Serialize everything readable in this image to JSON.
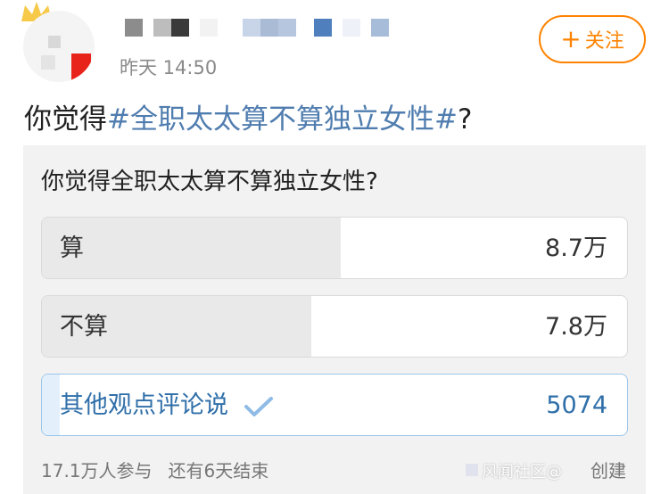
{
  "post": {
    "time": "昨天 14:50",
    "follow_label": "关注",
    "follow_plus": "+",
    "text_prefix": "你觉得",
    "topic": "#全职太太算不算独立女性#",
    "text_suffix": "?"
  },
  "poll": {
    "question": "你觉得全职太太算不算独立女性?",
    "options": [
      {
        "label": "算",
        "count": "8.7万",
        "share": 0.51,
        "selected": false
      },
      {
        "label": "不算",
        "count": "7.8万",
        "share": 0.46,
        "selected": false
      },
      {
        "label": "其他观点评论说",
        "count": "5074",
        "share": 0.03,
        "selected": true
      }
    ],
    "participants": "17.1万人参与",
    "remaining": "还有6天结束",
    "creator_label": "创建"
  },
  "colors": {
    "accent": "#ff8200",
    "topic": "#507daf",
    "selected": "#2f6fa9"
  },
  "watermark": "风闻社区@"
}
